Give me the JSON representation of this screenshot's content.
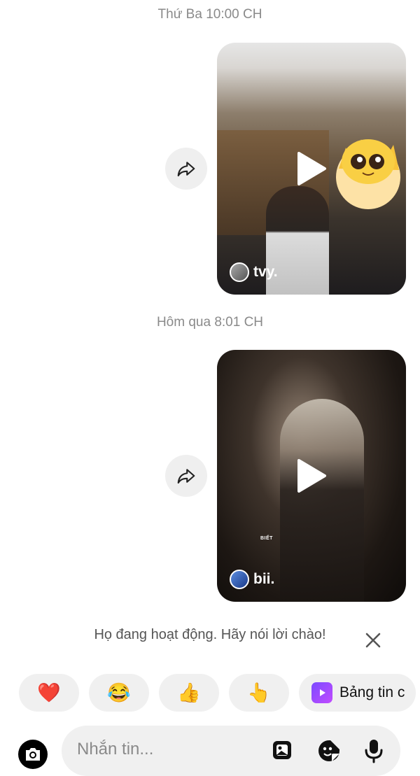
{
  "thread": {
    "messages": [
      {
        "timestamp": "Thứ Ba 10:00 CH",
        "reel_author": "tvy.",
        "caption": ""
      },
      {
        "timestamp": "Hôm qua 8:01 CH",
        "reel_author": "bii.",
        "caption": "BIẾT"
      }
    ]
  },
  "hint": {
    "text": "Họ đang hoạt động. Hãy nói lời chào!"
  },
  "quick_replies": {
    "emojis": [
      "❤️",
      "😂",
      "👍",
      "👆"
    ],
    "feed_label": "Bảng tin c"
  },
  "composer": {
    "placeholder": "Nhắn tin..."
  },
  "colors": {
    "background": "#ffffff",
    "chip": "#f0f0f0",
    "timestamp": "#8a8a8a"
  },
  "icons": [
    "share-icon",
    "play-icon",
    "close-icon",
    "camera-icon",
    "gallery-icon",
    "sticker-icon",
    "microphone-icon",
    "feed-icon"
  ]
}
